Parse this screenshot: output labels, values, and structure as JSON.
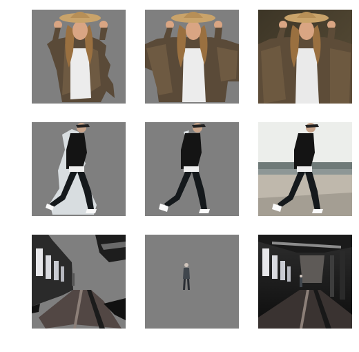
{
  "figure": {
    "background": "#ffffff",
    "mask_gray": "#7f7f7f",
    "rows": [
      {
        "subject": "woman-in-hat",
        "columns": [
          "masked-subject",
          "masked-subject-expanded",
          "original"
        ]
      },
      {
        "subject": "man-walking",
        "columns": [
          "masked-subject",
          "masked-subject-expanded",
          "original"
        ]
      },
      {
        "subject": "industrial-hall",
        "columns": [
          "masked-scene",
          "masked-person",
          "original"
        ]
      }
    ]
  }
}
